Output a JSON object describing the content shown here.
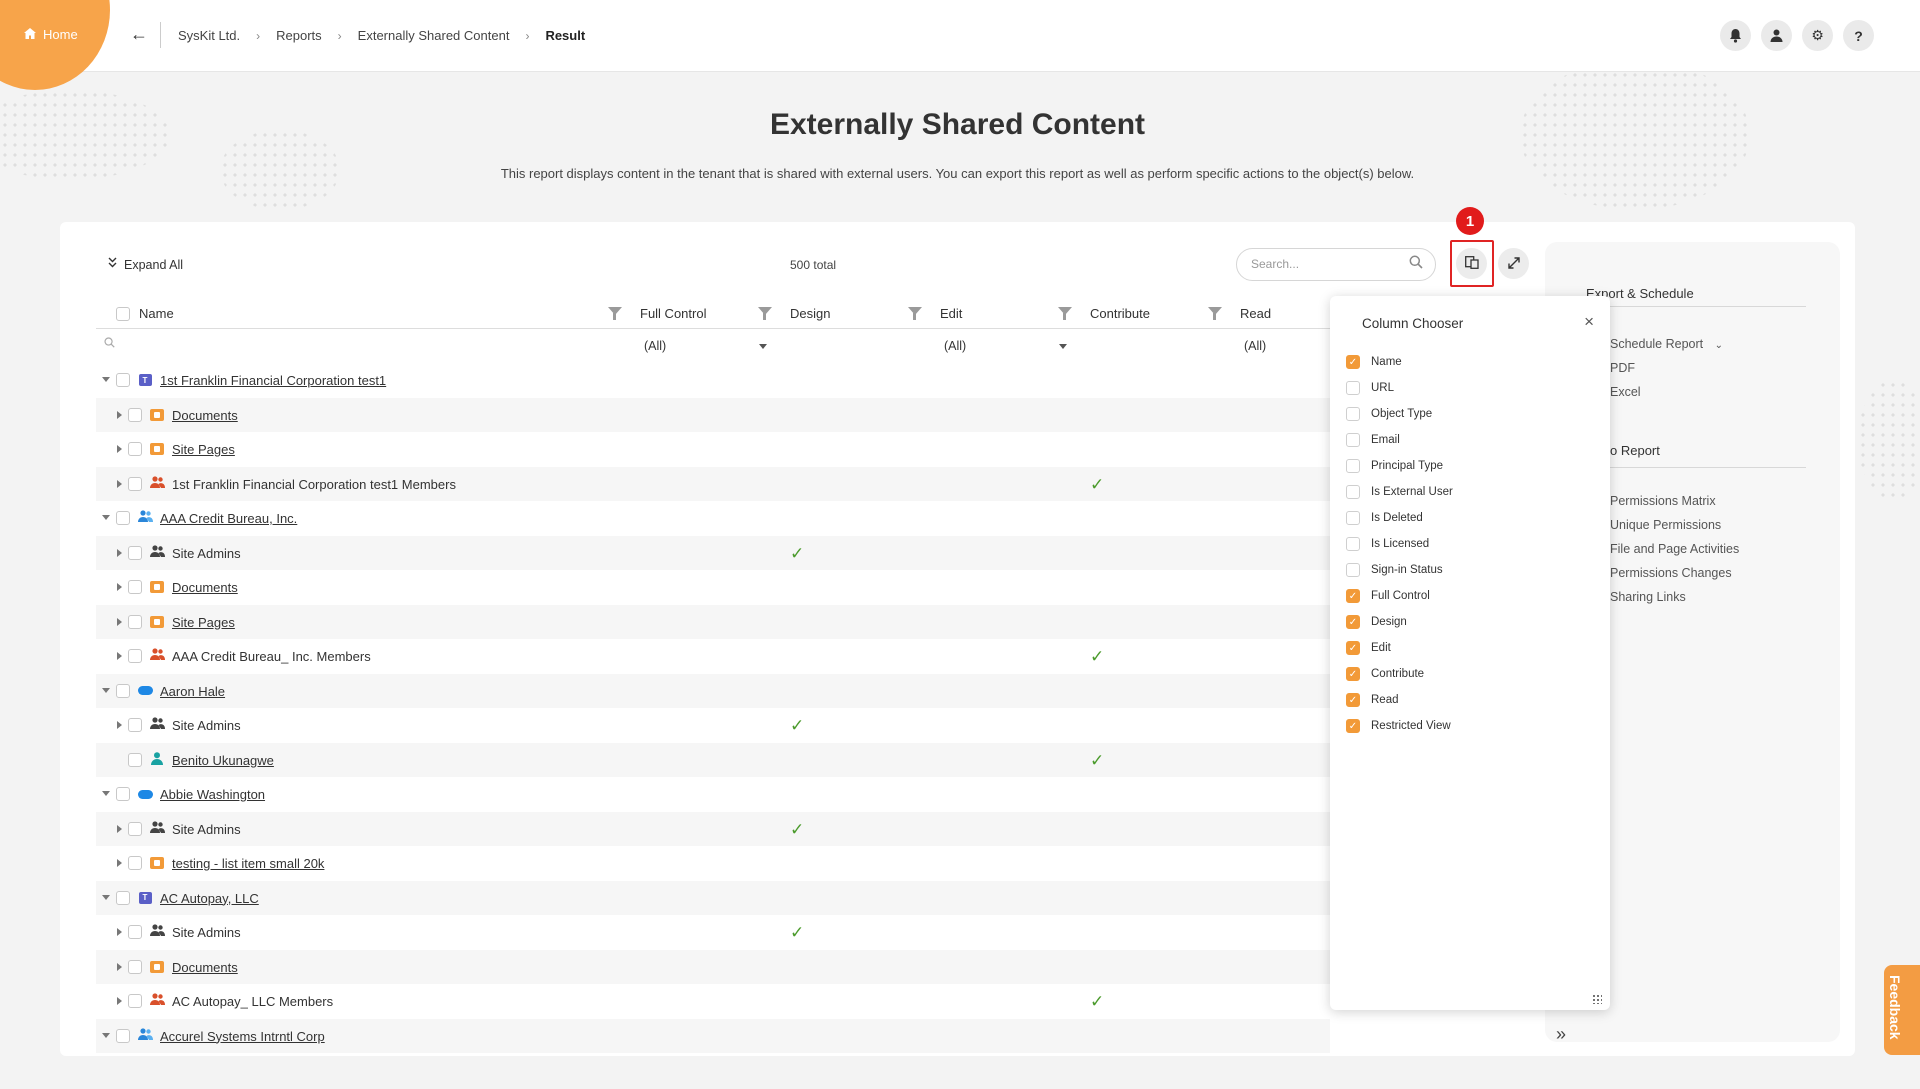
{
  "topbar": {
    "home_label": "Home",
    "breadcrumb": [
      "SysKit Ltd.",
      "Reports",
      "Externally Shared Content",
      "Result"
    ],
    "icons": [
      "bell-icon",
      "user-icon",
      "gear-icon",
      "help-icon"
    ]
  },
  "header": {
    "title": "Externally Shared Content",
    "description": "This report displays content in the tenant that is shared with external users. You can export this report as well as perform specific actions to the object(s) below."
  },
  "toolbar": {
    "expand_all": "Expand All",
    "total": "500 total",
    "search_placeholder": "Search...",
    "badge": "1"
  },
  "table": {
    "columns": {
      "name": "Name",
      "full_control": "Full Control",
      "design": "Design",
      "edit": "Edit",
      "contribute": "Contribute",
      "read": "Read"
    },
    "filters": {
      "full_control": "(All)",
      "edit": "(All)",
      "read": "(All)"
    },
    "rows": [
      {
        "level": 0,
        "expand": "down",
        "icon": "teams",
        "name": "1st Franklin Financial Corporation test1",
        "link": true,
        "check": ""
      },
      {
        "level": 1,
        "expand": "right",
        "icon": "library",
        "name": "Documents",
        "link": true,
        "check": ""
      },
      {
        "level": 1,
        "expand": "right",
        "icon": "library",
        "name": "Site Pages",
        "link": true,
        "check": ""
      },
      {
        "level": 1,
        "expand": "right",
        "icon": "group-red",
        "name": "1st Franklin Financial Corporation test1 Members",
        "link": false,
        "check": "edit"
      },
      {
        "level": 0,
        "expand": "down",
        "icon": "group-blue",
        "name": "AAA Credit Bureau, Inc.",
        "link": true,
        "check": ""
      },
      {
        "level": 1,
        "expand": "right",
        "icon": "group-dark",
        "name": "Site Admins",
        "link": false,
        "check": "full_control"
      },
      {
        "level": 1,
        "expand": "right",
        "icon": "library",
        "name": "Documents",
        "link": true,
        "check": ""
      },
      {
        "level": 1,
        "expand": "right",
        "icon": "library",
        "name": "Site Pages",
        "link": true,
        "check": ""
      },
      {
        "level": 1,
        "expand": "right",
        "icon": "group-red",
        "name": "AAA Credit Bureau_ Inc. Members",
        "link": false,
        "check": "edit"
      },
      {
        "level": 0,
        "expand": "down",
        "icon": "onedrive",
        "name": "Aaron Hale",
        "link": true,
        "check": ""
      },
      {
        "level": 1,
        "expand": "right",
        "icon": "group-dark",
        "name": "Site Admins",
        "link": false,
        "check": "full_control"
      },
      {
        "level": 1,
        "expand": "",
        "icon": "user-teal",
        "name": "Benito Ukunagwe",
        "link": true,
        "check": "edit"
      },
      {
        "level": 0,
        "expand": "down",
        "icon": "onedrive",
        "name": "Abbie Washington",
        "link": true,
        "check": ""
      },
      {
        "level": 1,
        "expand": "right",
        "icon": "group-dark",
        "name": "Site Admins",
        "link": false,
        "check": "full_control"
      },
      {
        "level": 1,
        "expand": "right",
        "icon": "library",
        "name": "testing - list item small 20k",
        "link": true,
        "check": ""
      },
      {
        "level": 0,
        "expand": "down",
        "icon": "teams",
        "name": "AC Autopay, LLC",
        "link": true,
        "check": ""
      },
      {
        "level": 1,
        "expand": "right",
        "icon": "group-dark",
        "name": "Site Admins",
        "link": false,
        "check": "full_control"
      },
      {
        "level": 1,
        "expand": "right",
        "icon": "library",
        "name": "Documents",
        "link": true,
        "check": ""
      },
      {
        "level": 1,
        "expand": "right",
        "icon": "group-red",
        "name": "AC Autopay_ LLC Members",
        "link": false,
        "check": "edit"
      },
      {
        "level": 0,
        "expand": "down",
        "icon": "group-blue",
        "name": "Accurel Systems Intrntl Corp",
        "link": true,
        "check": ""
      }
    ]
  },
  "column_chooser": {
    "title": "Column Chooser",
    "items": [
      {
        "label": "Name",
        "checked": true
      },
      {
        "label": "URL",
        "checked": false
      },
      {
        "label": "Object Type",
        "checked": false
      },
      {
        "label": "Email",
        "checked": false
      },
      {
        "label": "Principal Type",
        "checked": false
      },
      {
        "label": "Is External User",
        "checked": false
      },
      {
        "label": "Is Deleted",
        "checked": false
      },
      {
        "label": "Is Licensed",
        "checked": false
      },
      {
        "label": "Sign-in Status",
        "checked": false
      },
      {
        "label": "Full Control",
        "checked": true
      },
      {
        "label": "Design",
        "checked": true
      },
      {
        "label": "Edit",
        "checked": true
      },
      {
        "label": "Contribute",
        "checked": true
      },
      {
        "label": "Read",
        "checked": true
      },
      {
        "label": "Restricted View",
        "checked": true
      }
    ]
  },
  "right_panel": {
    "export_heading": "Export & Schedule",
    "export_items": [
      "Schedule Report",
      "PDF",
      "Excel"
    ],
    "goto_heading": "o Report",
    "goto_items": [
      "Permissions Matrix",
      "Unique Permissions",
      "File and Page Activities",
      "Permissions Changes",
      "Sharing Links"
    ]
  },
  "feedback_label": "Feedback",
  "colors": {
    "accent": "#f29a38",
    "check": "#4b9b2c",
    "badge": "#e11b1b"
  }
}
